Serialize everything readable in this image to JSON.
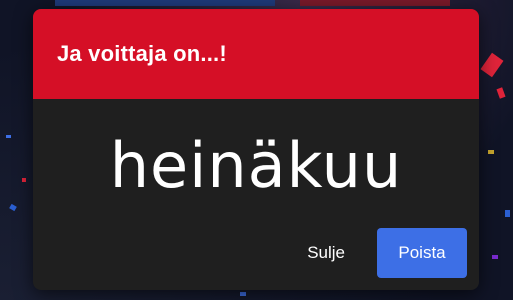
{
  "dialog": {
    "title": "Ja voittaja on...!",
    "winner": "heinäkuu",
    "close_label": "Sulje",
    "remove_label": "Poista"
  },
  "colors": {
    "header_red": "#d50f26",
    "dialog_bg": "#1f1f1f",
    "primary_blue": "#3d6fe6"
  }
}
